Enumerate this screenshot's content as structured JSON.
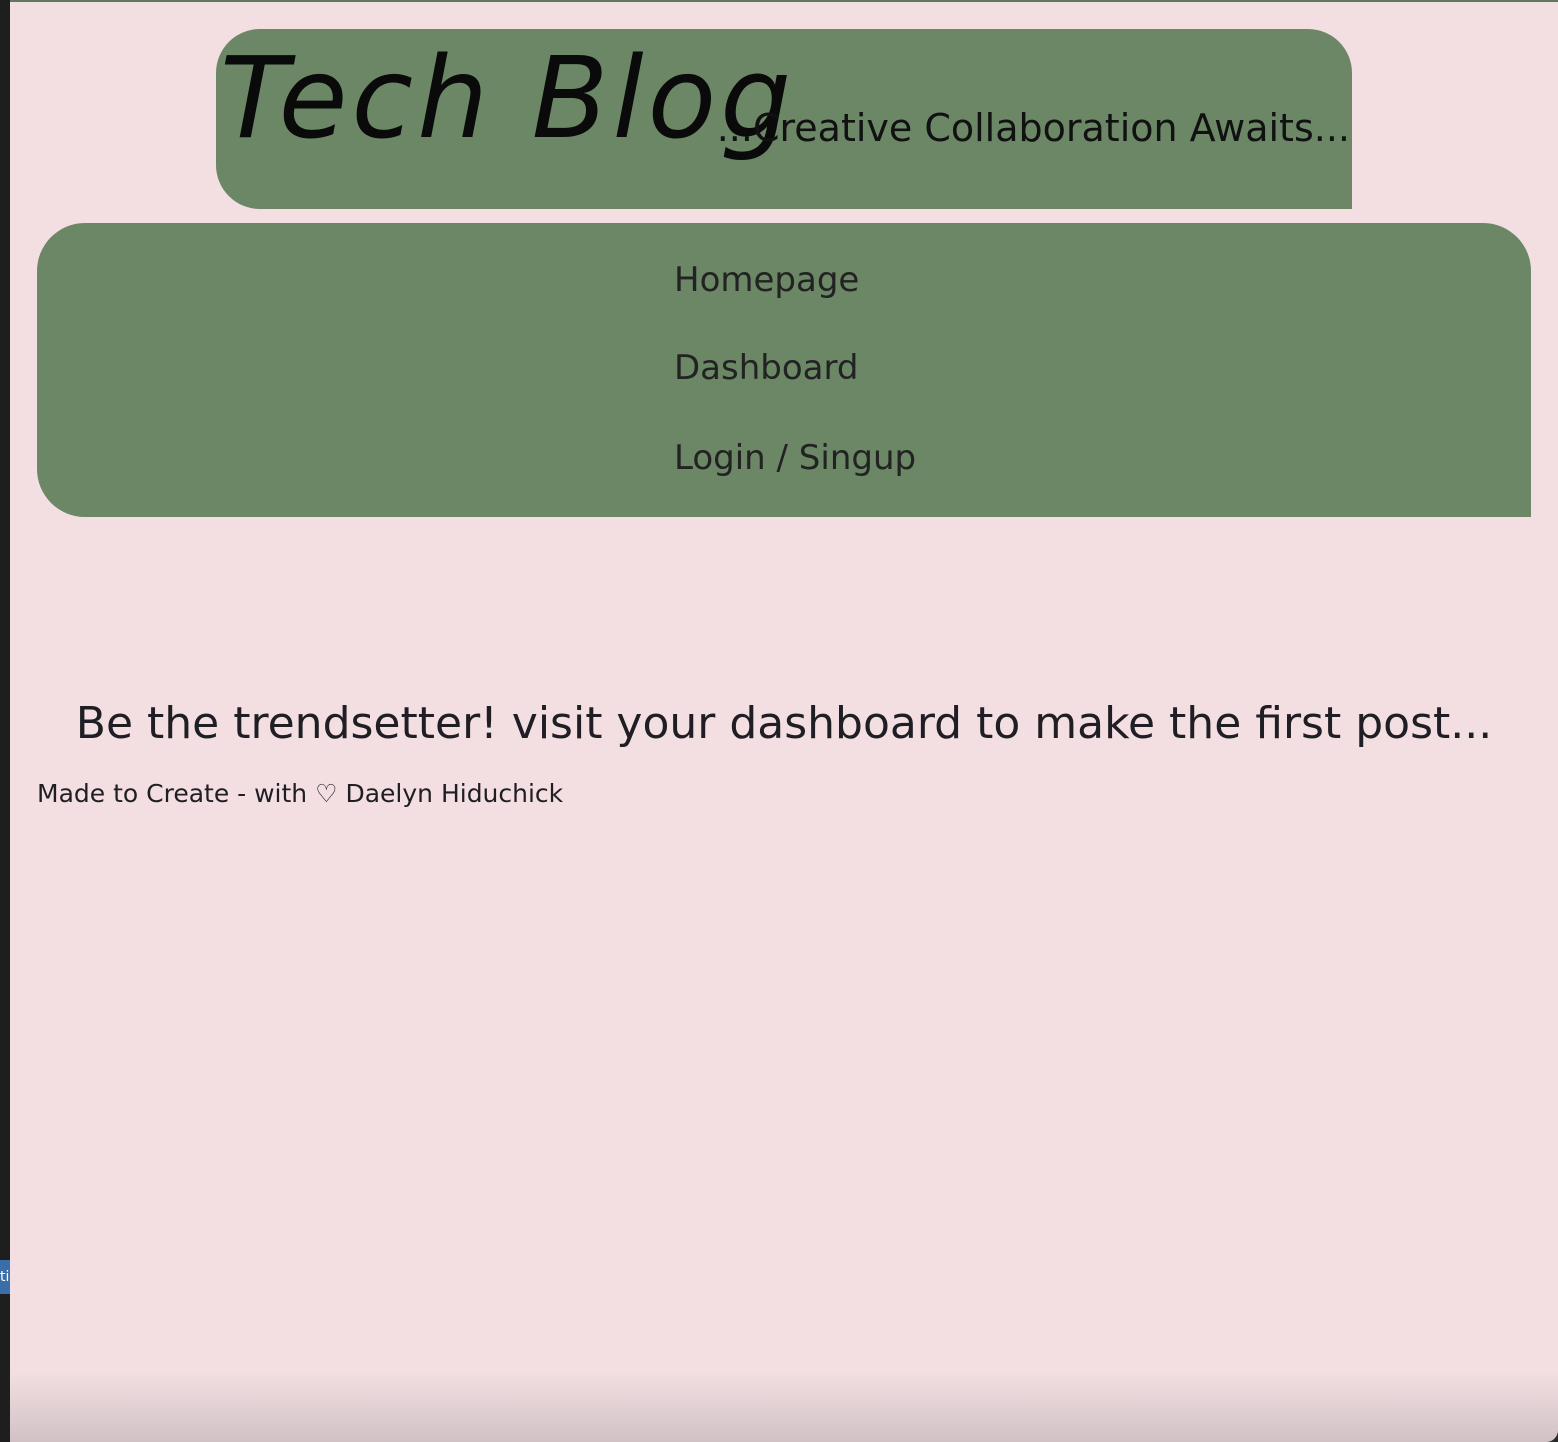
{
  "header": {
    "title": "Tech Blog",
    "tagline": "...Creative Collaboration Awaits..."
  },
  "nav": {
    "items": [
      {
        "label": "Homepage"
      },
      {
        "label": "Dashboard"
      },
      {
        "label": "Login / Singup"
      }
    ]
  },
  "main": {
    "message": "Be the trendsetter! visit your dashboard to make the first post..."
  },
  "footer": {
    "text": "Made to Create - with ♡ Daelyn Hiduchick"
  },
  "edge_tab": {
    "label": "ti"
  },
  "colors": {
    "background": "#f3dfe2",
    "panel": "#6b8766",
    "text": "#1f1e24"
  }
}
